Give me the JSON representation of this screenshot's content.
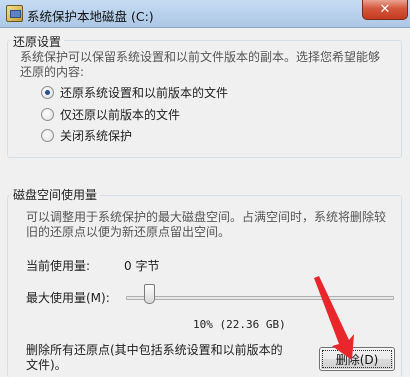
{
  "window": {
    "title": "系统保护本地磁盘 (C:)",
    "close_glyph": "✕"
  },
  "restore_settings": {
    "group_title": "还原设置",
    "description_line1": "系统保护可以保留系统设置和以前文件版本的副本。选择您希望能够",
    "description_line2": "还原的内容:",
    "options": [
      {
        "label": "还原系统设置和以前版本的文件",
        "checked": true
      },
      {
        "label": "仅还原以前版本的文件",
        "checked": false
      },
      {
        "label": "关闭系统保护",
        "checked": false
      }
    ]
  },
  "disk_usage": {
    "group_title": "磁盘空间使用量",
    "description_line1": "可以调整用于系统保护的最大磁盘空间。占满空间时，系统将删除较",
    "description_line2": "旧的还原点以便为新还原点留出空间。",
    "current_usage_label": "当前使用量:",
    "current_usage_value": "0 字节",
    "max_usage_label": "最大使用量(M):",
    "slider_percent": 10,
    "slider_value_text": "10% (22.36 GB)",
    "delete_text_line1": "删除所有还原点(其中包括系统设置和以前版本的",
    "delete_text_line2": "文件)。",
    "delete_button_label": "删除(D)"
  },
  "colors": {
    "annotation_arrow": "#e8262b",
    "radio_dot": "#2a4d8f"
  }
}
